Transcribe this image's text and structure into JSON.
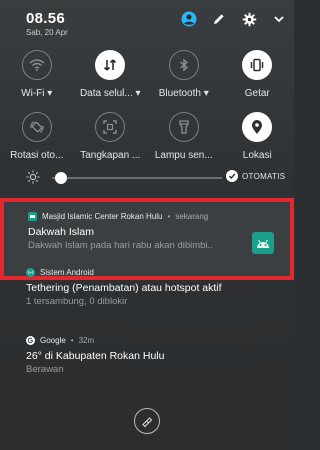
{
  "status": {
    "time": "08.56",
    "date": "Sab, 20 Apr"
  },
  "quick_settings": {
    "row1": [
      {
        "label": "Wi-Fi",
        "icon": "wifi-icon",
        "on": false
      },
      {
        "label": "Data selul...",
        "icon": "mobile-data-icon",
        "on": true
      },
      {
        "label": "Bluetooth",
        "icon": "bluetooth-icon",
        "on": false
      },
      {
        "label": "Getar",
        "icon": "vibrate-icon",
        "on": true
      }
    ],
    "row2": [
      {
        "label": "Rotasi oto...",
        "icon": "auto-rotate-icon",
        "on": false
      },
      {
        "label": "Tangkapan ...",
        "icon": "screenshot-icon",
        "on": false
      },
      {
        "label": "Lampu sen...",
        "icon": "flashlight-icon",
        "on": false
      },
      {
        "label": "Lokasi",
        "icon": "location-icon",
        "on": true
      }
    ]
  },
  "brightness": {
    "auto_label": "OTOMATIS",
    "level": 0.05
  },
  "notifications": [
    {
      "app": "Masjid Islamic Center Rokan Hulu",
      "time": "sekarang",
      "title": "Dakwah Islam",
      "body": "Dakwah Islam pada hari rabu akan dibimbi..",
      "highlighted": true
    },
    {
      "app": "Sistem Android",
      "title": "Tethering (Penambatan) atau hotspot aktif",
      "body": "1 tersambung, 0 diblokir"
    },
    {
      "app": "Google",
      "time": "32m",
      "title": "26° di Kabupaten Rokan Hulu",
      "body": "Berawan"
    }
  ],
  "colors": {
    "highlight_border": "#e3282f",
    "accent_teal": "#1aa08a",
    "account_icon": "#29b6f6",
    "google_icon": "#ffffff"
  }
}
